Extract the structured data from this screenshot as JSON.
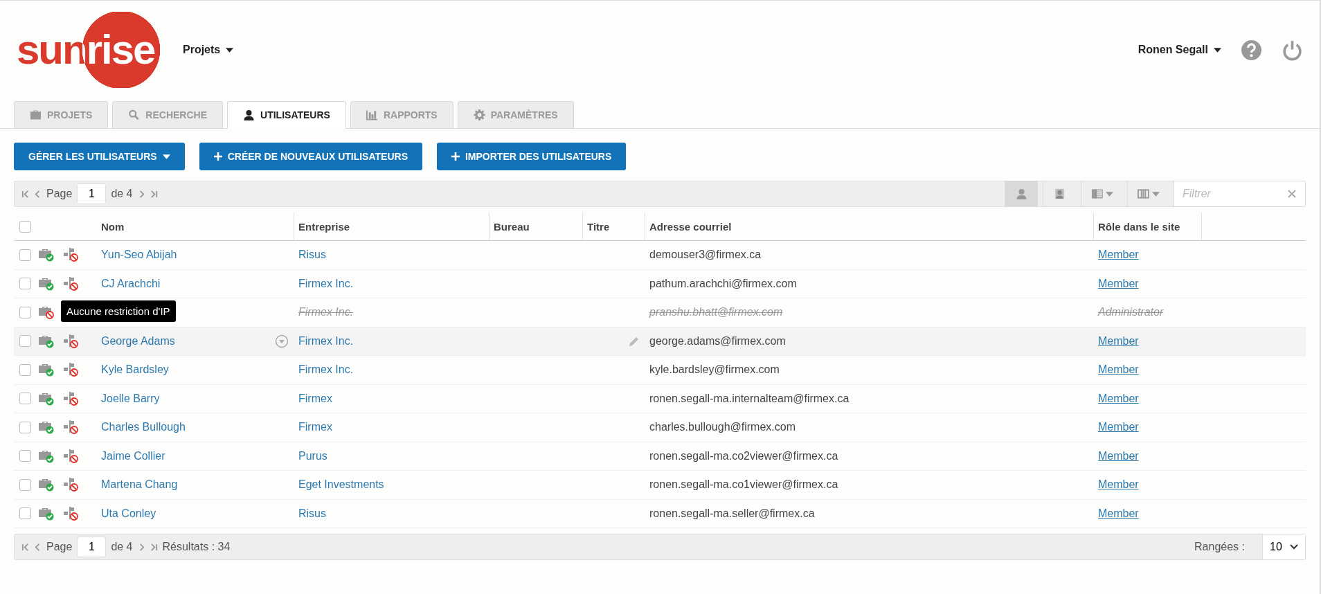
{
  "logo": {
    "text": "sunrise"
  },
  "project_menu": {
    "label": "Projets"
  },
  "user_menu": {
    "label": "Ronen Segall"
  },
  "tabs": [
    {
      "label": "PROJETS",
      "kind": "briefcase",
      "selected": false
    },
    {
      "label": "RECHERCHE",
      "kind": "search",
      "selected": false
    },
    {
      "label": "UTILISATEURS",
      "kind": "person",
      "selected": true
    },
    {
      "label": "RAPPORTS",
      "kind": "chart",
      "selected": false
    },
    {
      "label": "PARAMÈTRES",
      "kind": "gear",
      "selected": false
    }
  ],
  "actions": [
    {
      "label": "GÉRER LES UTILISATEURS",
      "kind": "dropdown"
    },
    {
      "label": "CRÉER DE NOUVEAUX UTILISATEURS",
      "kind": "add"
    },
    {
      "label": "IMPORTER DES UTILISATEURS",
      "kind": "add"
    }
  ],
  "pager_top": {
    "page_label": "Page",
    "page": "1",
    "of": "de 4"
  },
  "view_toggles": [
    {
      "kind": "person",
      "selected": true
    },
    {
      "kind": "contact",
      "selected": false
    }
  ],
  "filter": {
    "placeholder": "Filtrer"
  },
  "table": {
    "columns": [
      "Nom",
      "Entreprise",
      "Bureau",
      "Titre",
      "Adresse courriel",
      "Rôle dans le site"
    ],
    "all_checked": false,
    "rows": [
      {
        "name": "Yun-Seo Abijah",
        "company": "Risus",
        "email": "demouser3@firmex.ca",
        "role": "Member",
        "checked": false,
        "active": true,
        "access": true,
        "hovered": false
      },
      {
        "name": "CJ Arachchi",
        "company": "Firmex Inc.",
        "email": "pathum.arachchi@firmex.com",
        "role": "Member",
        "checked": false,
        "active": true,
        "access": true,
        "hovered": false
      },
      {
        "company": "Firmex Inc.",
        "email": "pranshu.bhatt@firmex.com",
        "role": "Administrator",
        "checked": false,
        "active": false,
        "access": false,
        "hovered": false
      },
      {
        "name": "George Adams",
        "company": "Firmex Inc.",
        "email": "george.adams@firmex.com",
        "role": "Member",
        "checked": false,
        "active": true,
        "access": true,
        "hovered": true,
        "ip_tooltip": "Aucune restriction d'IP"
      },
      {
        "name": "Kyle Bardsley",
        "company": "Firmex Inc.",
        "email": "kyle.bardsley@firmex.com",
        "role": "Member",
        "checked": false,
        "active": true,
        "access": true,
        "hovered": false
      },
      {
        "name": "Joelle Barry",
        "company": "Firmex",
        "email": "ronen.segall-ma.internalteam@firmex.ca",
        "role": "Member",
        "checked": false,
        "active": true,
        "access": true,
        "hovered": false
      },
      {
        "name": "Charles Bullough",
        "company": "Firmex",
        "email": "charles.bullough@firmex.com",
        "role": "Member",
        "checked": false,
        "active": true,
        "access": true,
        "hovered": false
      },
      {
        "name": "Jaime Collier",
        "company": "Purus",
        "email": "ronen.segall-ma.co2viewer@firmex.ca",
        "role": "Member",
        "checked": false,
        "active": true,
        "access": true,
        "hovered": false
      },
      {
        "name": "Martena Chang",
        "company": "Eget Investments",
        "email": "ronen.segall-ma.co1viewer@firmex.ca",
        "role": "Member",
        "checked": false,
        "active": true,
        "access": true,
        "hovered": false
      },
      {
        "name": "Uta Conley",
        "company": "Risus",
        "email": "ronen.segall-ma.seller@firmex.ca",
        "role": "Member",
        "checked": false,
        "active": true,
        "access": true,
        "hovered": false
      }
    ]
  },
  "pager_bottom": {
    "page_label": "Page",
    "page": "1",
    "of": "de 4",
    "results": "Résultats : 34"
  },
  "rows_per_page": {
    "label": "Rangées :",
    "value": "10"
  }
}
